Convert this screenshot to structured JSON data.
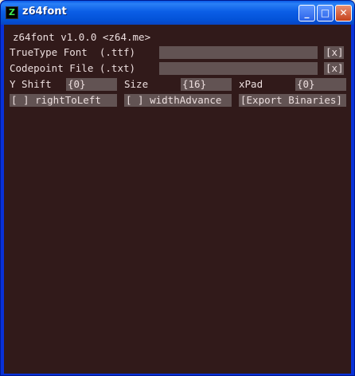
{
  "window": {
    "title": "z64font",
    "app_icon_glyph": "Z",
    "controls": {
      "minimize": "_",
      "maximize": "□",
      "close": "✕"
    }
  },
  "app": {
    "version_line": "z64font v1.0.0 <z64.me>",
    "truetype": {
      "label": "TrueType Font  (.ttf)",
      "value": "",
      "clear": "[x]"
    },
    "codepoint": {
      "label": "Codepoint File (.txt)",
      "value": "",
      "clear": "[x]"
    },
    "yshift": {
      "label": "Y Shift",
      "value": "{0}"
    },
    "size": {
      "label": "Size",
      "value": "{16}"
    },
    "xpad": {
      "label": "xPad",
      "value": "{0}"
    },
    "right_to_left": "[ ] rightToLeft",
    "width_advance": "[ ] widthAdvance",
    "export": "[Export Binaries]"
  },
  "colors": {
    "background": "#311a1a",
    "field": "#625353",
    "text": "#ecdede",
    "titlebar": "#0b5ee6"
  }
}
